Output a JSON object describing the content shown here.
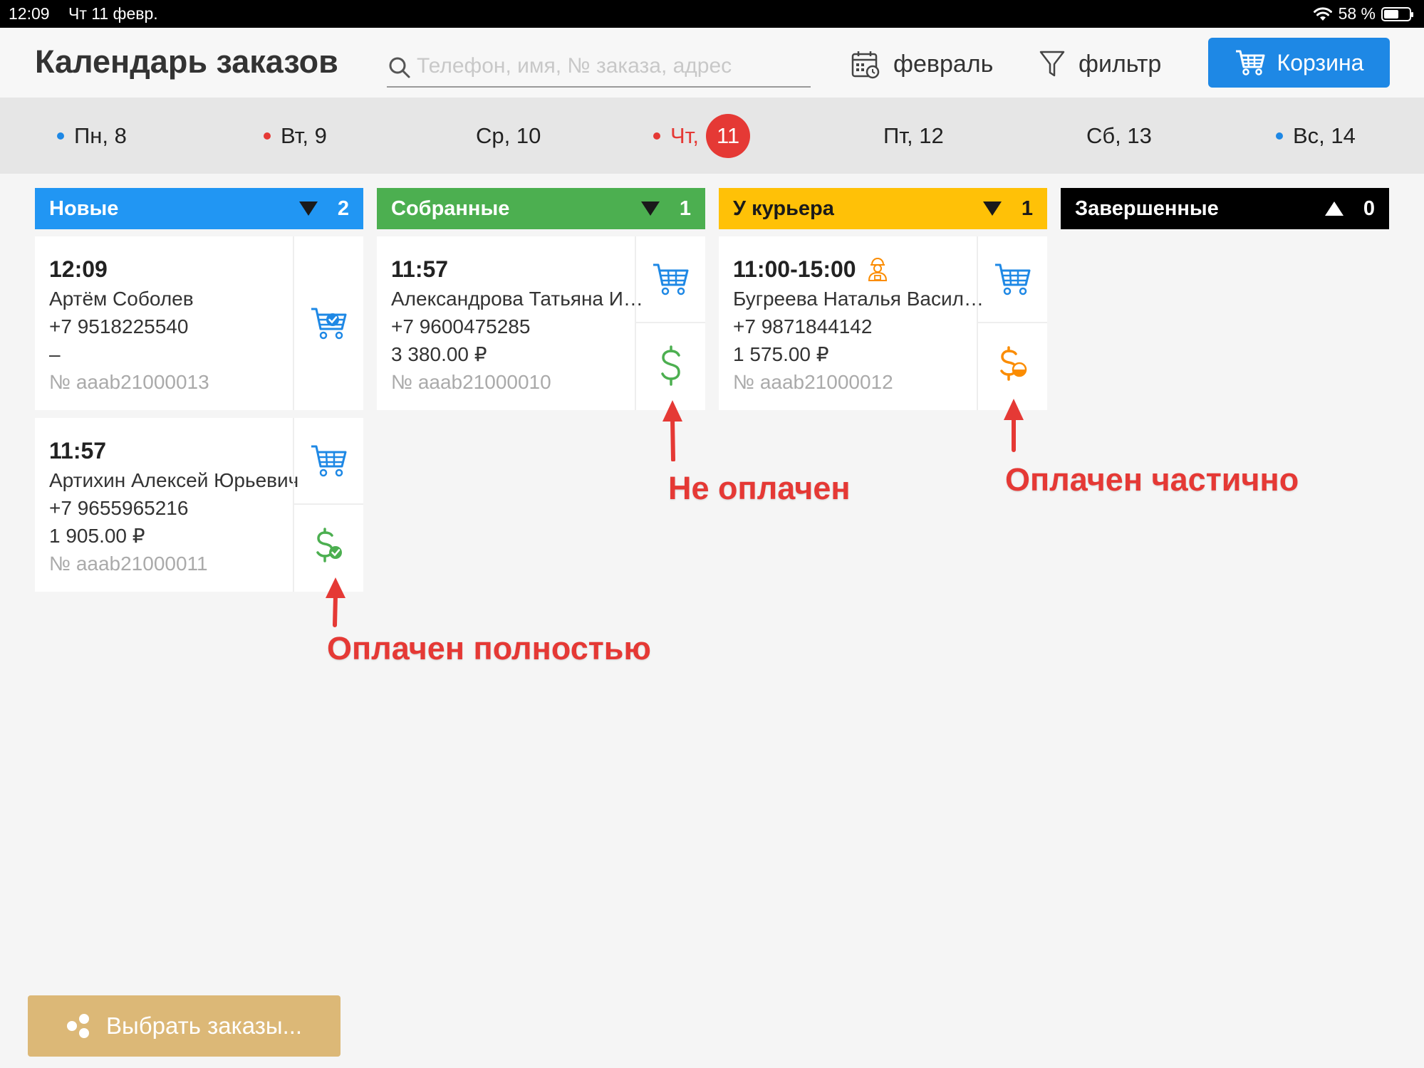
{
  "status_bar": {
    "time": "12:09",
    "date": "Чт 11 февр.",
    "battery": "58 %",
    "battery_level": 0.58
  },
  "header": {
    "title": "Календарь заказов",
    "search_placeholder": "Телефон, имя, № заказа, адрес",
    "month_label": "февраль",
    "filter_label": "фильтр",
    "cart_label": "Корзина"
  },
  "days": [
    {
      "label": "Пн, 8",
      "dot": "#1e88e5"
    },
    {
      "label": "Вт, 9",
      "dot": "#e53935"
    },
    {
      "label": "Ср, 10",
      "dot": null
    },
    {
      "label": "Чт,",
      "badge": "11",
      "dot": "#e53935",
      "current": true
    },
    {
      "label": "Пт, 12",
      "dot": null
    },
    {
      "label": "Сб, 13",
      "dot": null
    },
    {
      "label": "Вс, 14",
      "dot": "#1e88e5"
    }
  ],
  "columns": [
    {
      "name": "Новые",
      "count": "2",
      "color": "#2196f3",
      "arrow": "down"
    },
    {
      "name": "Собранные",
      "count": "1",
      "color": "#4caf50",
      "arrow": "down"
    },
    {
      "name": "У курьера",
      "count": "1",
      "color": "#ffc107",
      "arrow": "down"
    },
    {
      "name": "Завершенные",
      "count": "0",
      "color": "#000000",
      "arrow": "up"
    }
  ],
  "orders": {
    "new_1": {
      "time": "12:09",
      "name": "Артём Соболев",
      "phone": "+7 9518225540",
      "amount": "–",
      "number": "№ aaab21000013"
    },
    "new_2": {
      "time": "11:57",
      "name": "Артихин  Алексей  Юрьевич",
      "phone": "+7 9655965216",
      "amount": "1 905.00 ₽",
      "number": "№ aaab21000011"
    },
    "assembled_1": {
      "time": "11:57",
      "name": "Александрова Татьяна Ивановна",
      "phone": "+7 9600475285",
      "amount": "3 380.00 ₽",
      "number": "№ aaab21000010"
    },
    "courier_1": {
      "time": "11:00-15:00",
      "name": "Бугреева Наталья Васильевна",
      "phone": "+7 9871844142",
      "amount": "1 575.00 ₽",
      "number": "№ aaab21000012"
    }
  },
  "annotations": {
    "unpaid": "Не оплачен",
    "partial": "Оплачен частично",
    "full": "Оплачен полностью"
  },
  "bottom_button": "Выбрать заказы...",
  "colors": {
    "accent": "#1e88e5",
    "paid_green": "#4caf50",
    "partial_orange": "#fb8c00",
    "annotation_red": "#e53935",
    "select_button": "#dcb877"
  }
}
